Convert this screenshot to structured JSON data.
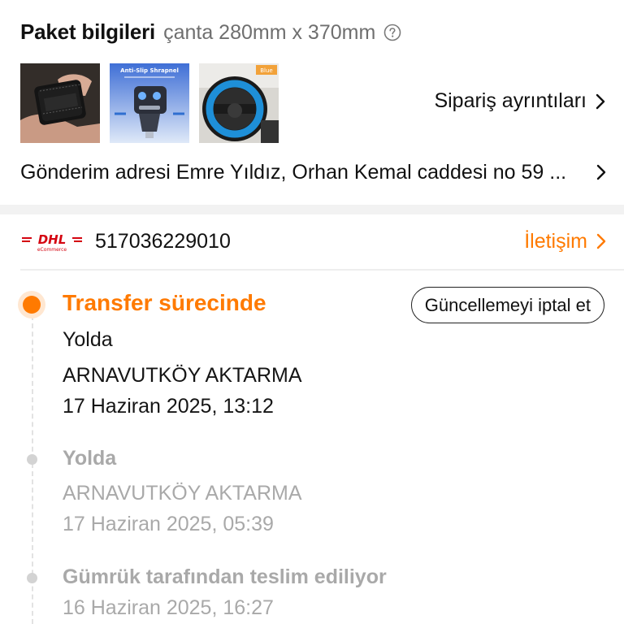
{
  "package": {
    "title": "Paket bilgileri",
    "subtitle": "çanta 280mm x 370mm",
    "help_icon": "question-circle-icon",
    "thumbnails": [
      {
        "name": "black-wallet-photo",
        "banner": ""
      },
      {
        "name": "car-charger-photo",
        "banner": "Anti-Slip Shrapnel"
      },
      {
        "name": "steering-wheel-cover-photo",
        "banner": "Blue"
      }
    ],
    "order_details_label": "Sipariş ayrıntıları",
    "shipping_label": "Gönderim adresi",
    "shipping_address": "Emre Yıldız, Orhan Kemal caddesi no 59 ..."
  },
  "carrier": {
    "logo_icon": "dhl-ecommerce-logo",
    "logo_text": "DHL",
    "logo_subtext": "eCommerce",
    "tracking_number": "517036229010",
    "contact_label": "İletişim",
    "accent_color": "#ff7a00"
  },
  "actions": {
    "cancel_update_label": "Güncellemeyi iptal et"
  },
  "timeline": [
    {
      "status": "Transfer sürecinde",
      "detail": "Yolda",
      "location": "ARNAVUTKÖY AKTARMA",
      "datetime": "17 Haziran 2025, 13:12",
      "active": true
    },
    {
      "status": "Yolda",
      "location": "ARNAVUTKÖY AKTARMA",
      "datetime": "17 Haziran 2025, 05:39",
      "active": false
    },
    {
      "status": "Gümrük tarafından teslim ediliyor",
      "datetime": "16 Haziran 2025, 16:27",
      "active": false
    }
  ]
}
